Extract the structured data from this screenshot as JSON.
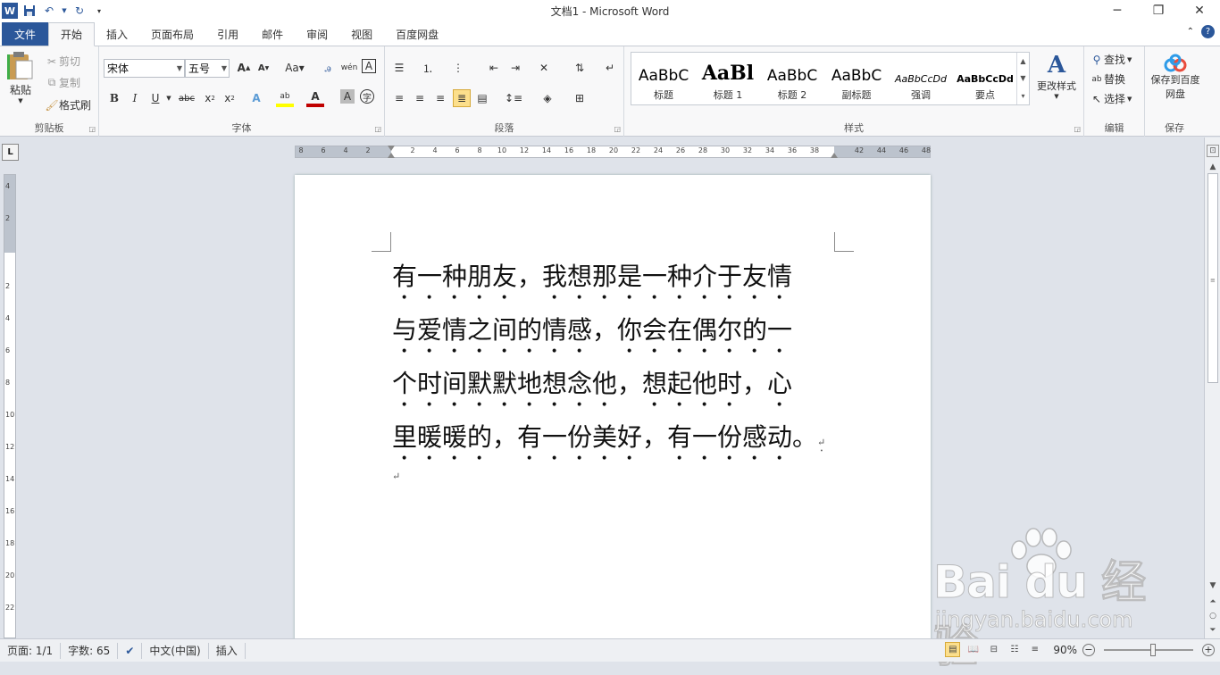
{
  "window": {
    "title": "文档1  -  Microsoft Word",
    "min": "─",
    "restore": "❐",
    "close": "✕"
  },
  "tabs": [
    {
      "label": "文件"
    },
    {
      "label": "开始"
    },
    {
      "label": "插入"
    },
    {
      "label": "页面布局"
    },
    {
      "label": "引用"
    },
    {
      "label": "邮件"
    },
    {
      "label": "审阅"
    },
    {
      "label": "视图"
    },
    {
      "label": "百度网盘"
    }
  ],
  "ribbon": {
    "clipboard": {
      "paste": "粘贴",
      "cut": "剪切",
      "copy": "复制",
      "format_painter": "格式刷",
      "label": "剪贴板"
    },
    "font": {
      "name": "宋体",
      "size": "五号",
      "label": "字体"
    },
    "paragraph": {
      "label": "段落"
    },
    "styles": {
      "label": "样式",
      "items": [
        {
          "sample": "AaBbC",
          "name": "标题"
        },
        {
          "sample": "AaBl",
          "name": "标题 1"
        },
        {
          "sample": "AaBbC",
          "name": "标题 2"
        },
        {
          "sample": "AaBbC",
          "name": "副标题"
        },
        {
          "sample": "AaBbCcDd",
          "name": "强调"
        },
        {
          "sample": "AaBbCcDd",
          "name": "要点"
        }
      ],
      "change": "更改样式"
    },
    "editing": {
      "find": "查找",
      "replace": "替换",
      "select": "选择",
      "label": "编辑"
    },
    "save": {
      "button": "保存到百度网盘",
      "label": "保存"
    }
  },
  "document": {
    "paragraph": "有一种朋友，我想那是一种介于友情与爱情之间的情感，你会在偶尔的一个时间默默地想念他，想起他时，心里暖暖的，有一份美好，有一份感动。",
    "lines": [
      "有一种朋友，我想那是一种介于友情",
      "与爱情之间的情感，你会在偶尔的一",
      "个时间默默地想念他，想起他时，心",
      "里暖暖的，有一份美好，有一份感动。"
    ],
    "para_mark": "↵"
  },
  "status": {
    "page": "页面: 1/1",
    "words": "字数: 65",
    "language": "中文(中国)",
    "mode": "插入",
    "zoom": "90%"
  },
  "ruler": {
    "h_ticks": [
      "8",
      "6",
      "4",
      "2",
      "2",
      "4",
      "6",
      "8",
      "10",
      "12",
      "14",
      "16",
      "18",
      "20",
      "22",
      "24",
      "26",
      "28",
      "30",
      "32",
      "34",
      "36",
      "38",
      "42",
      "44",
      "46",
      "48"
    ],
    "v_ticks": [
      "4",
      "2",
      "2",
      "4",
      "6",
      "8",
      "10",
      "12",
      "14",
      "16",
      "18",
      "20",
      "22"
    ]
  },
  "watermark": {
    "line1": "Bai du 经验",
    "line2": "jingyan.baidu.com"
  }
}
